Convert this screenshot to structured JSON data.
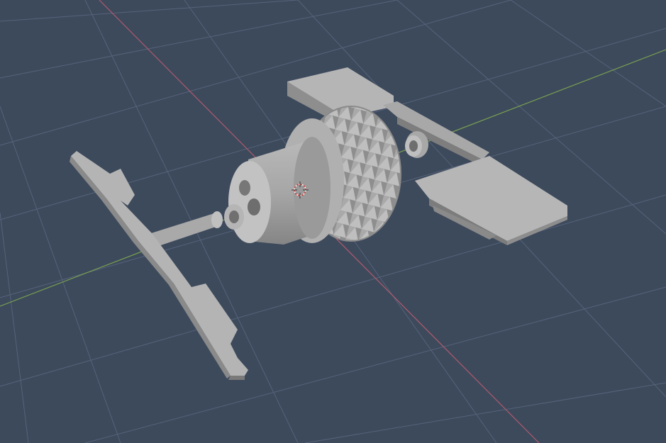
{
  "viewport": {
    "colors": {
      "background": "#3d4a5c",
      "grid": "#56627a",
      "axis_x": "#b05a6e",
      "axis_y": "#7aa050",
      "model_light": "#b4b4b4",
      "model_mid": "#9c9c9c",
      "model_dark": "#7c7c7c"
    },
    "objects": [
      {
        "name": "left-bracket",
        "kind": "mesh"
      },
      {
        "name": "axle-pin",
        "kind": "mesh"
      },
      {
        "name": "hub-cylinder",
        "kind": "mesh"
      },
      {
        "name": "knurled-wheel",
        "kind": "mesh"
      },
      {
        "name": "right-bracket",
        "kind": "mesh"
      },
      {
        "name": "small-bushing",
        "kind": "mesh"
      }
    ],
    "origin_marker_icon": "3d-cursor-icon"
  }
}
